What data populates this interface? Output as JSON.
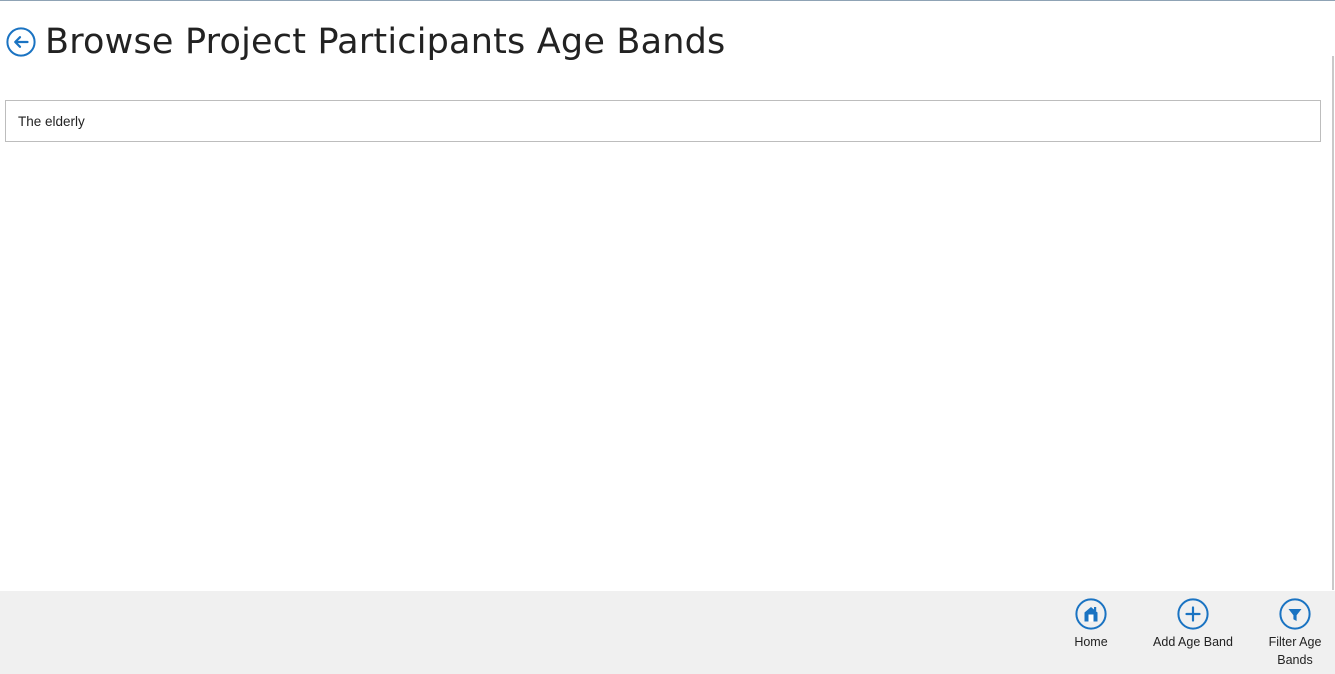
{
  "header": {
    "back_icon": "back-arrow-icon",
    "title": "Browse Project Participants Age Bands"
  },
  "list": {
    "items": [
      {
        "label": "The elderly"
      }
    ]
  },
  "app_bar": {
    "buttons": [
      {
        "label": "Home",
        "icon": "home-icon"
      },
      {
        "label": "Add Age Band",
        "icon": "add-icon"
      },
      {
        "label": "Filter Age Bands",
        "icon": "filter-icon"
      }
    ]
  },
  "colors": {
    "accent": "#1a73c2",
    "title_text": "#222222",
    "app_bar_background": "#f0f0f0",
    "list_border": "#bdbdbd"
  }
}
